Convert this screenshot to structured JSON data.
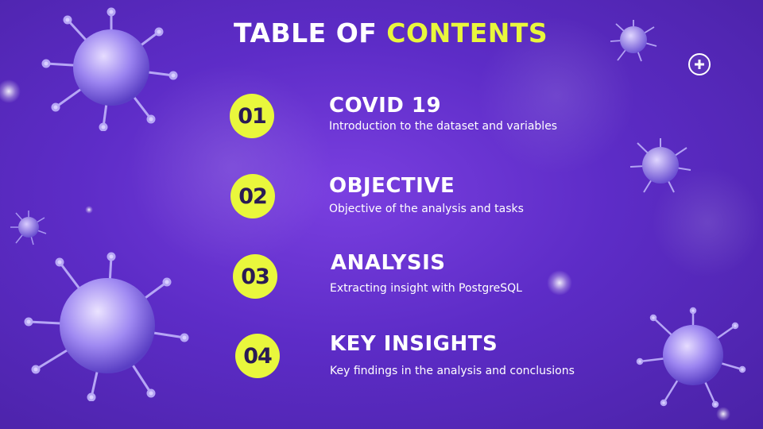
{
  "title": {
    "main": "TABLE OF",
    "accent": "CONTENTS"
  },
  "items": [
    {
      "number": "01",
      "title": "COVID 19",
      "description": "Introduction to the dataset and variables"
    },
    {
      "number": "02",
      "title": "OBJECTIVE",
      "description": "Objective of the analysis and tasks"
    },
    {
      "number": "03",
      "title": "ANALYSIS",
      "description": "Extracting insight with PostgreSQL"
    },
    {
      "number": "04",
      "title": "KEY INSIGHTS",
      "description": "Key findings in the analysis and conclusions"
    }
  ],
  "controls": {
    "add_icon": "plus-icon"
  },
  "colors": {
    "accent": "#e9f73c",
    "background": "#5d2cc7",
    "text": "#ffffff"
  }
}
